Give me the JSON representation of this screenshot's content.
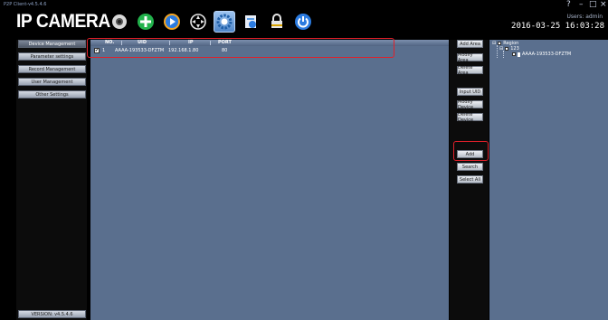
{
  "window": {
    "title": "P2P Client-v4.5.4.6",
    "controls": [
      "?",
      "–",
      "□",
      "×"
    ]
  },
  "brand": {
    "logo_text": "IP CAMERA"
  },
  "toolbar": {
    "buttons": [
      {
        "icon": "camera-icon",
        "color": "#d9d9d9"
      },
      {
        "icon": "plus-circle-icon",
        "color": "#22b24c"
      },
      {
        "icon": "play-icon",
        "color": "#2b7be0"
      },
      {
        "icon": "ptz-icon",
        "color": "#e6e6e6"
      },
      {
        "icon": "settings-gear-icon",
        "color": "#3aa0ff",
        "active": true
      },
      {
        "icon": "record-file-icon",
        "color": "#5a9de6"
      },
      {
        "icon": "lock-icon",
        "color": "#e6e6e6"
      },
      {
        "icon": "power-icon",
        "color": "#2b7be0"
      }
    ]
  },
  "header": {
    "users_label": "Users: admin",
    "datetime": "2016-03-25 16:03:28"
  },
  "sidebar": {
    "items": [
      {
        "label": "Device Management",
        "selected": true
      },
      {
        "label": "Parameter settings",
        "selected": false
      },
      {
        "label": "Record Management",
        "selected": false
      },
      {
        "label": "User Management",
        "selected": false
      },
      {
        "label": "Other Settings",
        "selected": false
      }
    ],
    "version_label": "VERSION: v4.5.4.6"
  },
  "device_table": {
    "columns": [
      "NO.",
      "UID",
      "IP",
      "PORT"
    ],
    "rows": [
      {
        "checked": true,
        "no": "1",
        "uid": "AAAA-193533-DFZTM",
        "ip": "192.168.1.80",
        "port": "80"
      }
    ]
  },
  "actions": {
    "add_area": "Add Area",
    "modify_area": "Modify Area",
    "delete_area": "Delete Area",
    "input_uid": "Input UID",
    "modify_device": "Modify Device",
    "delete_device": "Delete Device",
    "add": "Add",
    "search": "Search",
    "select_all": "Select All"
  },
  "tree": {
    "root": "Region",
    "area": "123",
    "device": "AAAA-193533-DFZTM"
  },
  "colors": {
    "panel_bg": "#5a6f8e",
    "highlight": "#e0202a"
  }
}
